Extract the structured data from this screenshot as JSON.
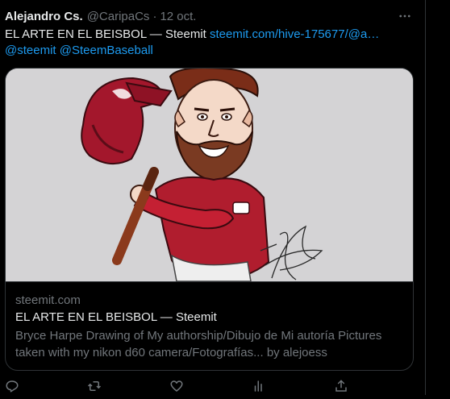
{
  "tweet": {
    "author_name": "Alejandro Cs.",
    "author_handle": "@CaripaCs",
    "separator": "·",
    "date": "12 oct.",
    "text_plain": "EL ARTE EN EL BEISBOL — Steemit ",
    "text_link": "steemit.com/hive-175677/@a…",
    "mention_1": "@steemit",
    "mention_2": "@SteemBaseball"
  },
  "card": {
    "domain": "steemit.com",
    "title": "EL ARTE EN EL BEISBOL — Steemit",
    "description": "Bryce Harpe Drawing of My authorship/Dibujo de Mi autoría Pictures taken with my nikon d60 camera/Fotografías... by alejoess"
  },
  "actions": {
    "icons": [
      "reply-icon",
      "retweet-icon",
      "like-icon",
      "views-icon",
      "share-icon"
    ]
  },
  "colors": {
    "background": "#000000",
    "text": "#e7e9ea",
    "muted": "#71767b",
    "link": "#1d9bf0",
    "border": "#2f3336"
  }
}
